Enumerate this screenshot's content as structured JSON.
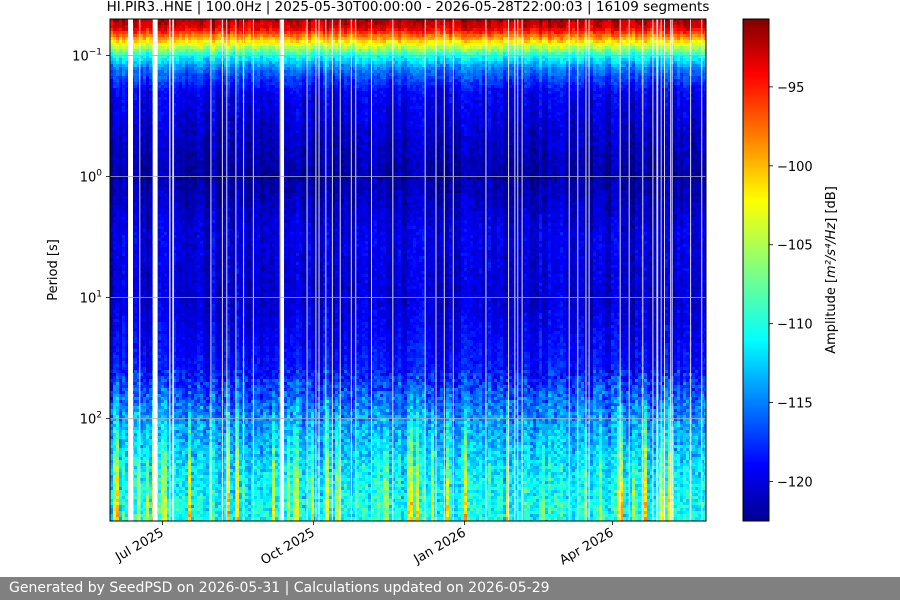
{
  "chart_data": {
    "type": "heatmap",
    "title": "HI.PIR3..HNE | 100.0Hz | 2025-05-30T00:00:00 - 2026-05-28T22:00:03 | 16109 segments",
    "ylabel": "Period [s]",
    "y_scale": "log",
    "y_inverted": true,
    "ylim": [
      0.05,
      700
    ],
    "y_ticks": [
      {
        "label_base": "10",
        "label_exp": "−1",
        "value": 0.1
      },
      {
        "label_base": "10",
        "label_exp": "0",
        "value": 1
      },
      {
        "label_base": "10",
        "label_exp": "1",
        "value": 10
      },
      {
        "label_base": "10",
        "label_exp": "2",
        "value": 100
      }
    ],
    "xlim": [
      "2025-05-30",
      "2026-05-28"
    ],
    "x_ticks": [
      {
        "label": "Jul 2025",
        "date": "2025-07-01"
      },
      {
        "label": "Oct 2025",
        "date": "2025-10-01"
      },
      {
        "label": "Jan 2026",
        "date": "2026-01-01"
      },
      {
        "label": "Apr 2026",
        "date": "2026-04-01"
      }
    ],
    "grid": true,
    "colormap": "jet",
    "colorbar": {
      "label_prefix": "Amplitude [",
      "label_unit": "m²/s⁴/Hz",
      "label_suffix": "] [dB]",
      "range": [
        -122.5,
        -90.7
      ],
      "ticks": [
        -95,
        -100,
        -105,
        -110,
        -115,
        -120
      ],
      "tick_labels": [
        "−95",
        "−100",
        "−105",
        "−110",
        "−115",
        "−120"
      ]
    },
    "amplitude_profile_db": [
      {
        "period": 0.05,
        "value": -92
      },
      {
        "period": 0.06,
        "value": -94
      },
      {
        "period": 0.07,
        "value": -99
      },
      {
        "period": 0.085,
        "value": -105
      },
      {
        "period": 0.1,
        "value": -110
      },
      {
        "period": 0.13,
        "value": -115
      },
      {
        "period": 0.2,
        "value": -119
      },
      {
        "period": 0.5,
        "value": -120.5
      },
      {
        "period": 1,
        "value": -121.5
      },
      {
        "period": 3,
        "value": -119.5
      },
      {
        "period": 10,
        "value": -120
      },
      {
        "period": 40,
        "value": -118
      },
      {
        "period": 100,
        "value": -114
      },
      {
        "period": 300,
        "value": -111
      },
      {
        "period": 700,
        "value": -110
      }
    ],
    "data_gaps": [
      {
        "start": "2025-06-10",
        "end": "2025-06-13"
      },
      {
        "start": "2025-06-25",
        "end": "2025-06-28"
      },
      {
        "start": "2025-09-11",
        "end": "2025-09-13"
      }
    ]
  },
  "footer": {
    "text": "Generated by SeedPSD on 2026-05-31 | Calculations updated on 2026-05-29"
  }
}
